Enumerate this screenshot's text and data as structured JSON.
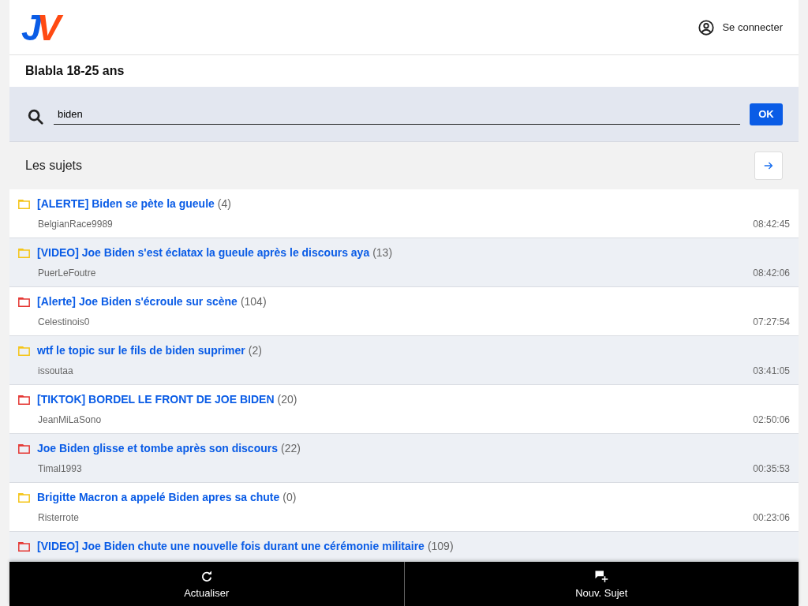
{
  "header": {
    "logo": [
      {
        "letter": "J",
        "color": "#0a5ce6"
      },
      {
        "letter": "V",
        "color": "#ff4a12"
      }
    ],
    "login": "Se connecter"
  },
  "forum_title": "Blabla 18-25 ans",
  "search": {
    "value": "biden",
    "button": "OK"
  },
  "section": {
    "title": "Les sujets"
  },
  "topics": [
    {
      "title": "[ALERTE] Biden se pète la gueule",
      "count": "(4)",
      "author": "BelgianRace9989",
      "time": "08:42:45",
      "color": "#f5c518"
    },
    {
      "title": "[VIDEO] Joe Biden s'est éclatax la gueule après le discours aya",
      "count": "(13)",
      "author": "PuerLeFoutre",
      "time": "08:42:06",
      "color": "#f5c518"
    },
    {
      "title": "[Alerte] Joe Biden s'écroule sur scène",
      "count": "(104)",
      "author": "Celestinois0",
      "time": "07:27:54",
      "color": "#e53935"
    },
    {
      "title": "wtf le topic sur le fils de biden suprimer",
      "count": "(2)",
      "author": "issoutaa",
      "time": "03:41:05",
      "color": "#f5c518"
    },
    {
      "title": "[TIKTOK] BORDEL LE FRONT DE JOE BIDEN",
      "count": "(20)",
      "author": "JeanMiLaSono",
      "time": "02:50:06",
      "color": "#e53935"
    },
    {
      "title": "Joe Biden glisse et tombe après son discours",
      "count": "(22)",
      "author": "Timal1993",
      "time": "00:35:53",
      "color": "#e53935"
    },
    {
      "title": "Brigitte Macron a appelé Biden apres sa chute",
      "count": "(0)",
      "author": "Risterrote",
      "time": "00:23:06",
      "color": "#f5c518"
    },
    {
      "title": "[VIDEO] Joe Biden chute une nouvelle fois durant une cérémonie militaire",
      "count": "(109)",
      "color": "#e53935"
    }
  ],
  "bottom_bar": [
    {
      "kind": "refresh",
      "label": "Actualiser"
    },
    {
      "kind": "new",
      "label": "Nouv. Sujet"
    }
  ]
}
